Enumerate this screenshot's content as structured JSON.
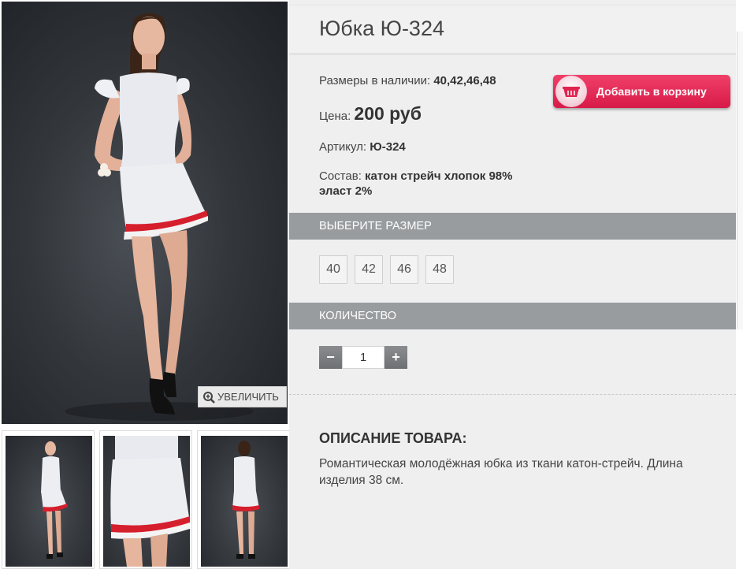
{
  "product": {
    "title": "Юбка Ю-324",
    "sizes_label": "Размеры в наличии:",
    "sizes_value": "40,42,46,48",
    "price_label": "Цена:",
    "price_value": "200 руб",
    "sku_label": "Артикул:",
    "sku_value": "Ю-324",
    "composition_label": "Состав:",
    "composition_value_line1": "катон стрейч хлопок 98%",
    "composition_value_line2": "эласт 2%"
  },
  "cart_button": {
    "label": "Добавить в корзину",
    "icon": "basket-icon"
  },
  "zoom_button": {
    "label": "УВЕЛИЧИТЬ",
    "icon": "magnifier-plus-icon"
  },
  "size_section": {
    "title": "ВЫБЕРИТЕ РАЗМЕР",
    "options": [
      "40",
      "42",
      "46",
      "48"
    ]
  },
  "quantity_section": {
    "title": "КОЛИЧЕСТВО",
    "value": "1",
    "minus": "−",
    "plus": "+"
  },
  "description": {
    "title": "ОПИСАНИЕ ТОВАРА:",
    "text": "Романтическая молодёжная юбка из ткани катон-стрейч. Длина изделия 38 см."
  },
  "colors": {
    "cart_accent": "#e0234f",
    "section_bar": "#999c9f",
    "panel_bg": "#efefef"
  }
}
